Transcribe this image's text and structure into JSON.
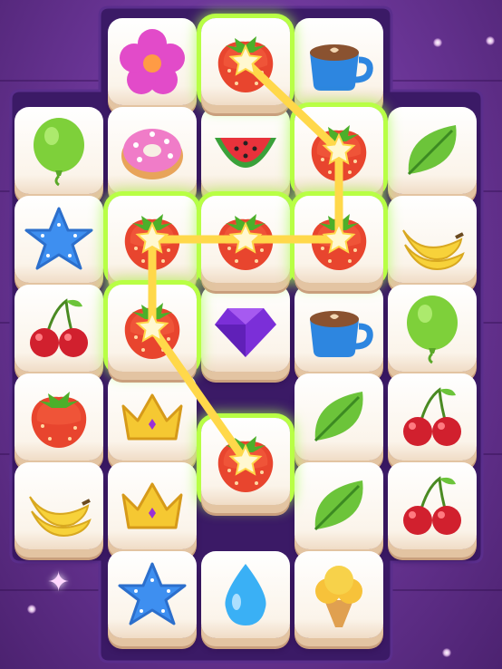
{
  "board": {
    "tiles": [
      {
        "name": "flower",
        "icon": "flower-icon",
        "col": 1,
        "row": 0,
        "glow": false
      },
      {
        "name": "strawberry",
        "icon": "strawberry-icon",
        "col": 2,
        "row": 0,
        "glow": true,
        "selected": true
      },
      {
        "name": "coffee",
        "icon": "coffee-icon",
        "col": 3,
        "row": 0,
        "glow": false
      },
      {
        "name": "balloon",
        "icon": "balloon-icon",
        "col": 0,
        "row": 1,
        "glow": false
      },
      {
        "name": "donut",
        "icon": "donut-icon",
        "col": 1,
        "row": 1,
        "glow": false
      },
      {
        "name": "watermelon",
        "icon": "watermelon-icon",
        "col": 2,
        "row": 1,
        "glow": false
      },
      {
        "name": "strawberry",
        "icon": "strawberry-icon",
        "col": 3,
        "row": 1,
        "glow": true,
        "selected": true
      },
      {
        "name": "leaf",
        "icon": "leaf-icon",
        "col": 4,
        "row": 1,
        "glow": false
      },
      {
        "name": "starfish",
        "icon": "starfish-icon",
        "col": 0,
        "row": 2,
        "glow": false
      },
      {
        "name": "strawberry",
        "icon": "strawberry-icon",
        "col": 1,
        "row": 2,
        "glow": true,
        "selected": true
      },
      {
        "name": "strawberry",
        "icon": "strawberry-icon",
        "col": 2,
        "row": 2,
        "glow": true,
        "selected": true
      },
      {
        "name": "strawberry",
        "icon": "strawberry-icon",
        "col": 3,
        "row": 2,
        "glow": true,
        "selected": true
      },
      {
        "name": "banana",
        "icon": "banana-icon",
        "col": 4,
        "row": 2,
        "glow": false
      },
      {
        "name": "cherry",
        "icon": "cherry-icon",
        "col": 0,
        "row": 3,
        "glow": false
      },
      {
        "name": "strawberry",
        "icon": "strawberry-icon",
        "col": 1,
        "row": 3,
        "glow": true,
        "selected": true
      },
      {
        "name": "gem",
        "icon": "gem-icon",
        "col": 2,
        "row": 3,
        "glow": false
      },
      {
        "name": "coffee",
        "icon": "coffee-icon",
        "col": 3,
        "row": 3,
        "glow": false
      },
      {
        "name": "balloon",
        "icon": "balloon-icon",
        "col": 4,
        "row": 3,
        "glow": false
      },
      {
        "name": "strawberry",
        "icon": "strawberry-icon",
        "col": 0,
        "row": 4,
        "glow": false
      },
      {
        "name": "crown",
        "icon": "crown-icon",
        "col": 1,
        "row": 4,
        "glow": false
      },
      {
        "name": "leaf",
        "icon": "leaf-icon",
        "col": 3,
        "row": 4,
        "glow": false
      },
      {
        "name": "cherry",
        "icon": "cherry-icon",
        "col": 4,
        "row": 4,
        "glow": false
      },
      {
        "name": "strawberry",
        "icon": "strawberry-icon",
        "col": 2,
        "row": 4.5,
        "glow": true,
        "selected": true
      },
      {
        "name": "banana",
        "icon": "banana-icon",
        "col": 0,
        "row": 5,
        "glow": false
      },
      {
        "name": "crown",
        "icon": "crown-icon",
        "col": 1,
        "row": 5,
        "glow": false
      },
      {
        "name": "leaf",
        "icon": "leaf-icon",
        "col": 3,
        "row": 5,
        "glow": false
      },
      {
        "name": "cherry",
        "icon": "cherry-icon",
        "col": 4,
        "row": 5,
        "glow": false
      },
      {
        "name": "starfish",
        "icon": "starfish-icon",
        "col": 1,
        "row": 6,
        "glow": false
      },
      {
        "name": "water-drop",
        "icon": "water-drop-icon",
        "col": 2,
        "row": 6,
        "glow": false
      },
      {
        "name": "ice-cream",
        "icon": "ice-cream-icon",
        "col": 3,
        "row": 6,
        "glow": false
      }
    ],
    "match_path": {
      "color": "#ffd84a",
      "nodes": [
        [
          2,
          0
        ],
        [
          3,
          1
        ],
        [
          3,
          2
        ],
        [
          2,
          2
        ],
        [
          1,
          2
        ],
        [
          1,
          3
        ],
        [
          2,
          4.5
        ]
      ]
    }
  },
  "colors": {
    "glow": "#b8ff45",
    "board": "#3b1a66",
    "background": "#6a3596"
  }
}
